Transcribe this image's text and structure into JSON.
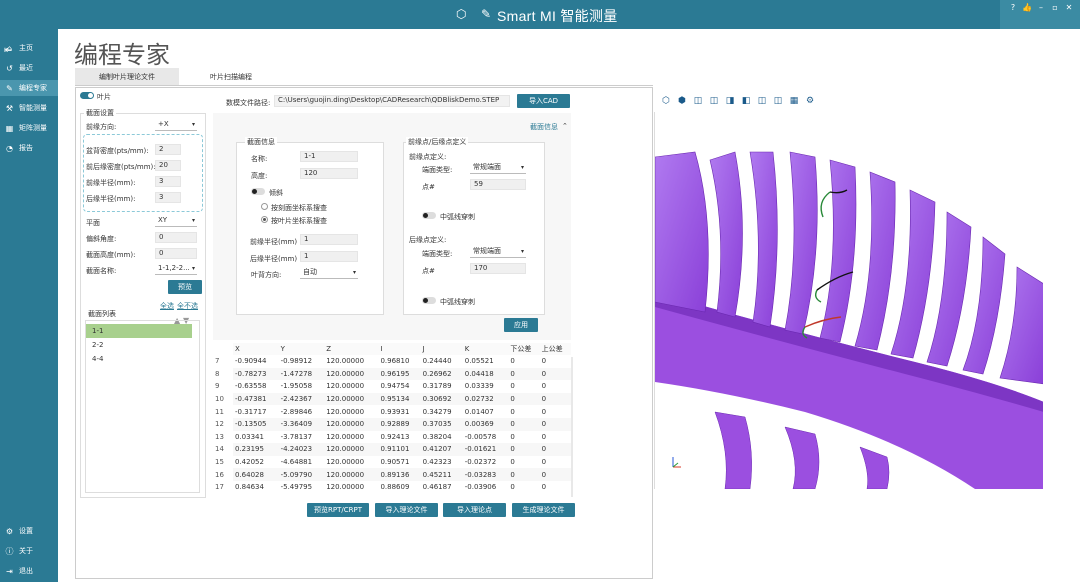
{
  "app": {
    "title": "Smart MI 智能测量"
  },
  "sidebar": {
    "items": [
      {
        "icon": "home-icon",
        "label": "主页"
      },
      {
        "icon": "history-icon",
        "label": "最近"
      },
      {
        "icon": "programming-icon",
        "label": "编程专家"
      },
      {
        "icon": "measure-icon",
        "label": "智能测量"
      },
      {
        "icon": "matrix-icon",
        "label": "矩阵测量"
      },
      {
        "icon": "report-icon",
        "label": "报告"
      }
    ],
    "bottom": [
      {
        "icon": "gear-icon",
        "label": "设置"
      },
      {
        "icon": "info-icon",
        "label": "关于"
      },
      {
        "icon": "exit-icon",
        "label": "退出"
      }
    ]
  },
  "page": {
    "title": "编程专家"
  },
  "tabs": [
    {
      "label": "编制叶片理论文件"
    },
    {
      "label": "叶片扫描编程"
    }
  ],
  "left": {
    "toggle_label": "叶片",
    "section_group": "截面设置",
    "leading_dir_label": "前缘方向:",
    "leading_dir_value": "+X",
    "basin_density_label": "盆背密度(pts/mm):",
    "basin_density_value": "2",
    "le_density_label": "前后缘密度(pts/mm):",
    "le_density_value": "20",
    "le_radius_label": "前缘半径(mm):",
    "le_radius_value": "3",
    "te_radius_label": "后缘半径(mm):",
    "te_radius_value": "3",
    "plane_label": "平面",
    "plane_value": "XY",
    "tilt_label": "偏斜角度:",
    "tilt_value": "0",
    "height_label": "截面高度(mm):",
    "height_value": "0",
    "name_label": "截面名称:",
    "name_value": "1-1,2-2...",
    "preview_btn": "预览",
    "select_all": "全选",
    "select_none": "全不选",
    "list_title": "截面列表",
    "list": [
      "1-1",
      "2-2",
      "4-4"
    ]
  },
  "file": {
    "path_label": "数模文件路径:",
    "path_value": "C:\\Users\\guojin.ding\\Desktop\\CADResearch\\QDBliskDemo.STEP",
    "import_btn": "导入CAD"
  },
  "section_info": {
    "header": "截面信息",
    "group": "截面信息",
    "name_label": "名称:",
    "name_value": "1-1",
    "height_label": "高度:",
    "height_value": "120",
    "tilt_label": "倾斜",
    "opt1": "按刻面坐标系搜查",
    "opt2": "按叶片坐标系搜查",
    "le_radius_label": "前缘半径(mm)",
    "le_radius_value": "1",
    "te_radius_label": "后缘半径(mm)",
    "te_radius_value": "1",
    "blade_dir_label": "叶背方向:",
    "blade_dir_value": "自动"
  },
  "le_te": {
    "group": "前缘点/后缘点定义",
    "le_group": "前缘点定义:",
    "le_type_label": "端面类型:",
    "le_type_value": "常规端面",
    "le_pt_label": "点#",
    "le_pt_value": "59",
    "le_arc": "中弧线穿刺",
    "te_group": "后缘点定义:",
    "te_type_label": "端面类型:",
    "te_type_value": "常规端面",
    "te_pt_label": "点#",
    "te_pt_value": "170",
    "te_arc": "中弧线穿刺",
    "apply_btn": "应用"
  },
  "table": {
    "headers": [
      "X",
      "Y",
      "Z",
      "I",
      "J",
      "K",
      "下公差",
      "上公差"
    ],
    "rows": [
      [
        "7",
        "-0.90944",
        "-0.98912",
        "120.00000",
        "0.96810",
        "0.24440",
        "0.05521",
        "0",
        "0"
      ],
      [
        "8",
        "-0.78273",
        "-1.47278",
        "120.00000",
        "0.96195",
        "0.26962",
        "0.04418",
        "0",
        "0"
      ],
      [
        "9",
        "-0.63558",
        "-1.95058",
        "120.00000",
        "0.94754",
        "0.31789",
        "0.03339",
        "0",
        "0"
      ],
      [
        "10",
        "-0.47381",
        "-2.42367",
        "120.00000",
        "0.95134",
        "0.30692",
        "0.02732",
        "0",
        "0"
      ],
      [
        "11",
        "-0.31717",
        "-2.89846",
        "120.00000",
        "0.93931",
        "0.34279",
        "0.01407",
        "0",
        "0"
      ],
      [
        "12",
        "-0.13505",
        "-3.36409",
        "120.00000",
        "0.92889",
        "0.37035",
        "0.00369",
        "0",
        "0"
      ],
      [
        "13",
        "0.03341",
        "-3.78137",
        "120.00000",
        "0.92413",
        "0.38204",
        "-0.00578",
        "0",
        "0"
      ],
      [
        "14",
        "0.23195",
        "-4.24023",
        "120.00000",
        "0.91101",
        "0.41207",
        "-0.01621",
        "0",
        "0"
      ],
      [
        "15",
        "0.42052",
        "-4.64881",
        "120.00000",
        "0.90571",
        "0.42323",
        "-0.02372",
        "0",
        "0"
      ],
      [
        "16",
        "0.64028",
        "-5.09790",
        "120.00000",
        "0.89136",
        "0.45211",
        "-0.03283",
        "0",
        "0"
      ],
      [
        "17",
        "0.84634",
        "-5.49795",
        "120.00000",
        "0.88609",
        "0.46187",
        "-0.03906",
        "0",
        "0"
      ]
    ]
  },
  "actions": {
    "preview": "预览RPT/CRPT",
    "import_theory_file": "导入理论文件",
    "import_theory_point": "导入理论点",
    "generate": "生成理论文件"
  },
  "colors": {
    "primary": "#2b7a94",
    "blade": "#9d4de0",
    "selected": "#a8d08d"
  }
}
